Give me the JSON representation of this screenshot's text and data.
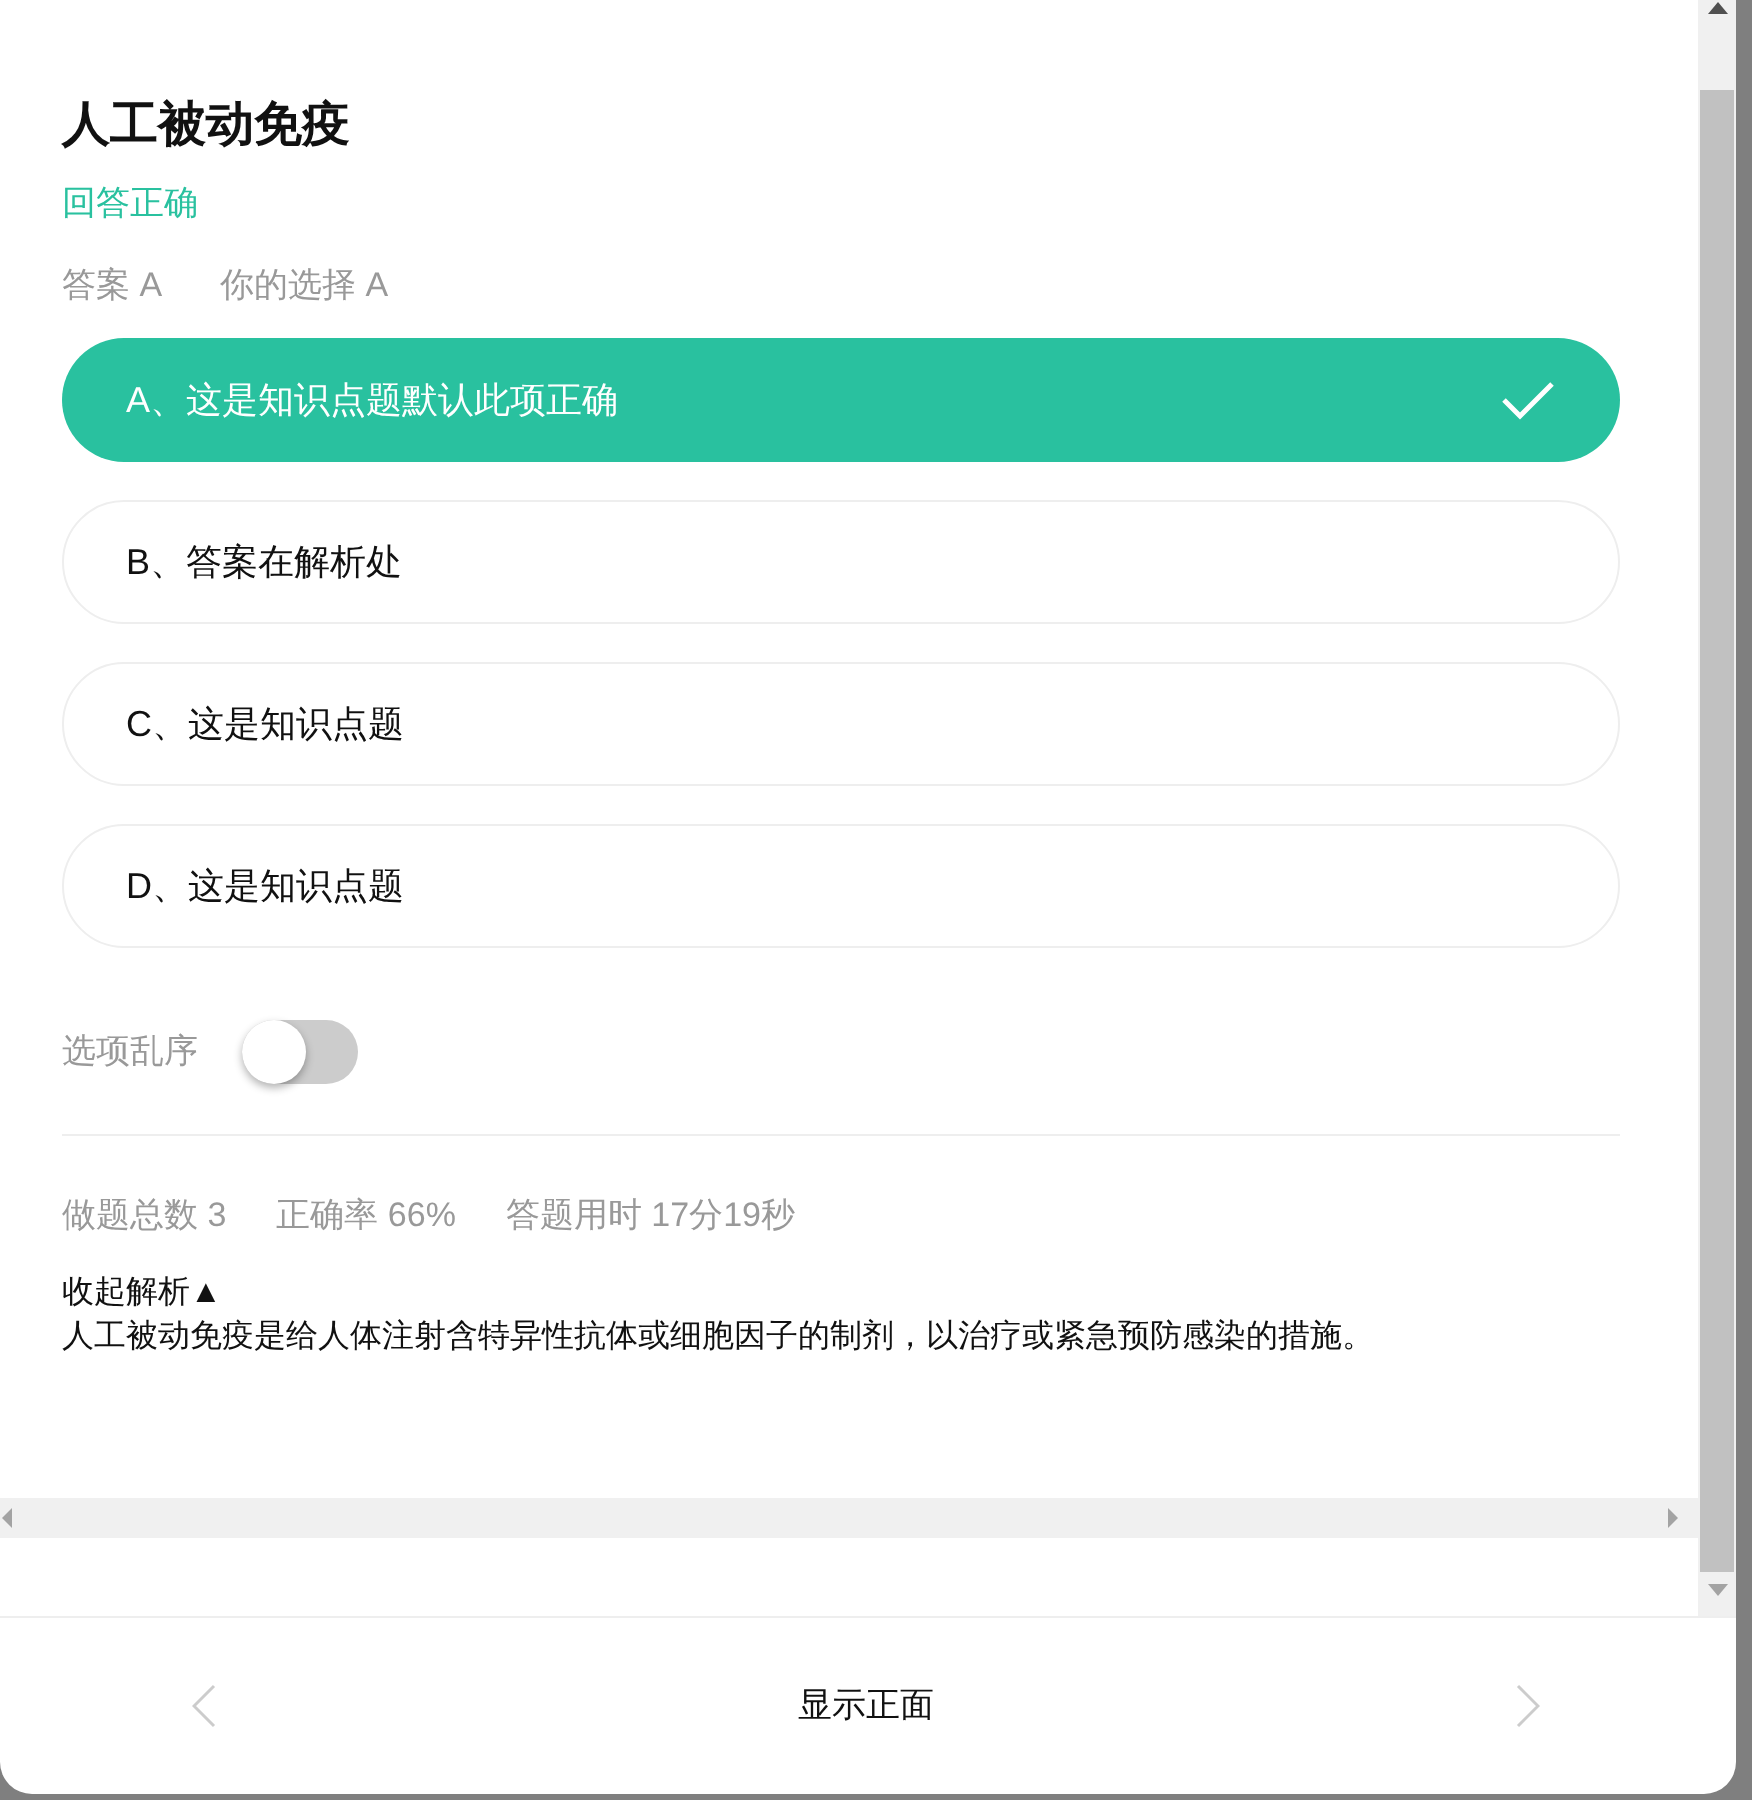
{
  "title": "人工被动免疫",
  "result": "回答正确",
  "answer": "答案 A",
  "choice": "你的选择 A",
  "options": [
    {
      "label": "A、这是知识点题默认此项正确",
      "selected": true
    },
    {
      "label": "B、答案在解析处",
      "selected": false
    },
    {
      "label": "C、这是知识点题",
      "selected": false
    },
    {
      "label": "D、这是知识点题",
      "selected": false
    }
  ],
  "shuffle": {
    "label": "选项乱序",
    "on": false
  },
  "stats": [
    "做题总数 3",
    "正确率 66%",
    "答题用时 17分19秒"
  ],
  "analysis_toggle": "收起解析▲",
  "analysis": "人工被动免疫是给人体注射含特异性抗体或细胞因子的制剂，以治疗或紧急预防感染的措施。",
  "footer_button": "显示正面"
}
